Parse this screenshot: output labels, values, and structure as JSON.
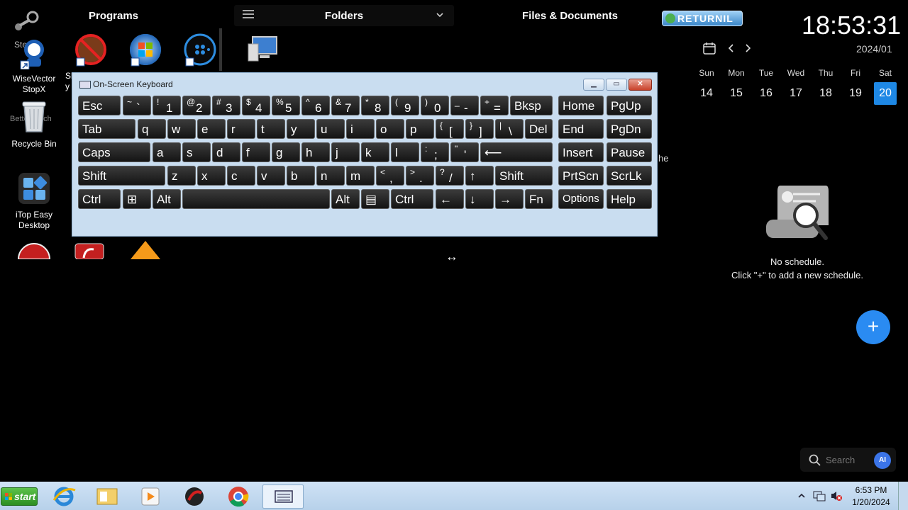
{
  "headers": {
    "programs": "Programs",
    "folders": "Folders",
    "files": "Files & Documents",
    "returnil": "RETURNIL"
  },
  "clock": "18:53:31",
  "calendar": {
    "month": "2024/01",
    "days_of_week": [
      "Sun",
      "Mon",
      "Tue",
      "Wed",
      "Thu",
      "Fri",
      "Sat"
    ],
    "dates": [
      "14",
      "15",
      "16",
      "17",
      "18",
      "19",
      "20"
    ],
    "selected": "20",
    "accent": "#1e88e5"
  },
  "schedule": {
    "empty_line1": "No schedule.",
    "empty_line2": "Click \"+\" to add a new schedule.",
    "add_label": "+"
  },
  "search": {
    "placeholder": "Search",
    "ai_label": "AI"
  },
  "desktop_icons": {
    "wisevector": "WiseVector StopX",
    "recycle": "Recycle Bin",
    "itop": "iTop Easy Desktop",
    "steam_partial": "Ste",
    "better_partial": "BetterTouch",
    "sl_partial": "Sl\ny",
    "right_partial": "he"
  },
  "osk": {
    "title": "On-Screen Keyboard",
    "rows": [
      [
        "Esc",
        "~ `",
        "! 1",
        "@ 2",
        "# 3",
        "$ 4",
        "% 5",
        "^ 6",
        "& 7",
        "* 8",
        "( 9",
        ") 0",
        "_ -",
        "+ =",
        "Bksp",
        "Home",
        "PgUp"
      ],
      [
        "Tab",
        "q",
        "w",
        "e",
        "r",
        "t",
        "y",
        "u",
        "i",
        "o",
        "p",
        "{ [",
        "} ]",
        "| \\",
        "Del",
        "End",
        "PgDn"
      ],
      [
        "Caps",
        "a",
        "s",
        "d",
        "f",
        "g",
        "h",
        "j",
        "k",
        "l",
        ": ;",
        "\" '",
        "Enter",
        "Insert",
        "Pause"
      ],
      [
        "Shift",
        "z",
        "x",
        "c",
        "v",
        "b",
        "n",
        "m",
        "< ,",
        "> .",
        "? /",
        "↑",
        "Shift",
        "PrtScn",
        "ScrLk"
      ],
      [
        "Ctrl",
        "Win",
        "Alt",
        "Space",
        "Alt",
        "Menu",
        "Ctrl",
        "←",
        "↓",
        "→",
        "Fn",
        "Options",
        "Help"
      ]
    ]
  },
  "taskbar": {
    "start": "start",
    "time": "6:53 PM",
    "date": "1/20/2024"
  }
}
